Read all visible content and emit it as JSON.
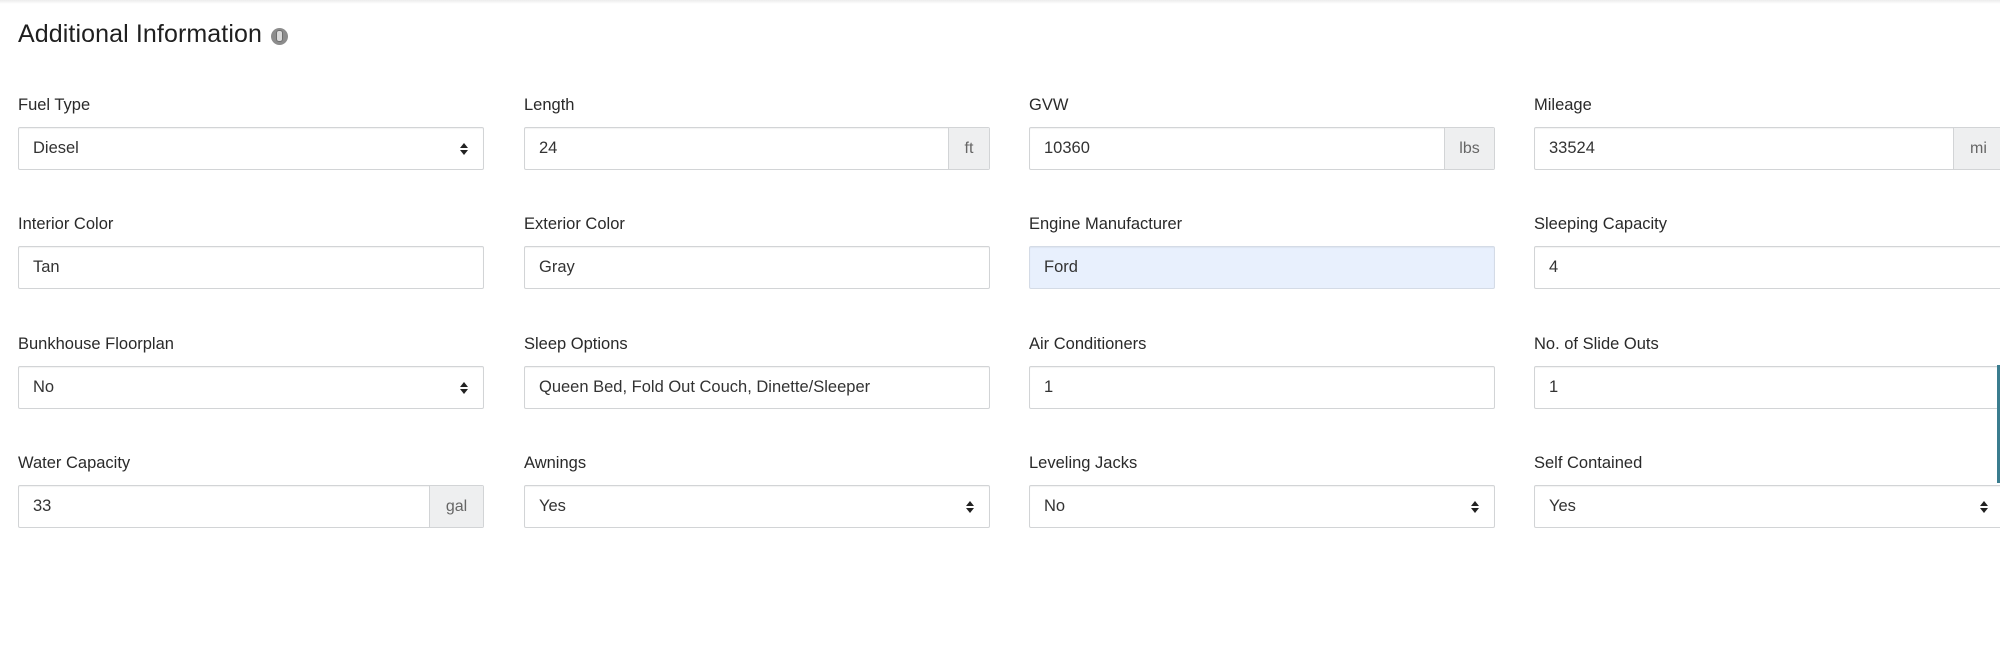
{
  "section": {
    "title": "Additional Information",
    "info_icon": "info-icon"
  },
  "fields": [
    {
      "label": "Fuel Type",
      "type": "select",
      "value": "Diesel"
    },
    {
      "label": "Length",
      "type": "input-addon",
      "value": "24",
      "unit": "ft"
    },
    {
      "label": "GVW",
      "type": "input-addon",
      "value": "10360",
      "unit": "lbs"
    },
    {
      "label": "Mileage",
      "type": "input-addon",
      "value": "33524",
      "unit": "mi"
    },
    {
      "label": "Interior Color",
      "type": "input",
      "value": "Tan"
    },
    {
      "label": "Exterior Color",
      "type": "input",
      "value": "Gray"
    },
    {
      "label": "Engine Manufacturer",
      "type": "input",
      "value": "Ford",
      "autofilled": true
    },
    {
      "label": "Sleeping Capacity",
      "type": "input",
      "value": "4"
    },
    {
      "label": "Bunkhouse Floorplan",
      "type": "select",
      "value": "No"
    },
    {
      "label": "Sleep Options",
      "type": "input",
      "value": "Queen Bed, Fold Out Couch, Dinette/Sleeper"
    },
    {
      "label": "Air Conditioners",
      "type": "input",
      "value": "1"
    },
    {
      "label": "No. of Slide Outs",
      "type": "input",
      "value": "1"
    },
    {
      "label": "Water Capacity",
      "type": "input-addon",
      "value": "33",
      "unit": "gal"
    },
    {
      "label": "Awnings",
      "type": "select",
      "value": "Yes"
    },
    {
      "label": "Leveling Jacks",
      "type": "select",
      "value": "No"
    },
    {
      "label": "Self Contained",
      "type": "select",
      "value": "Yes"
    }
  ]
}
